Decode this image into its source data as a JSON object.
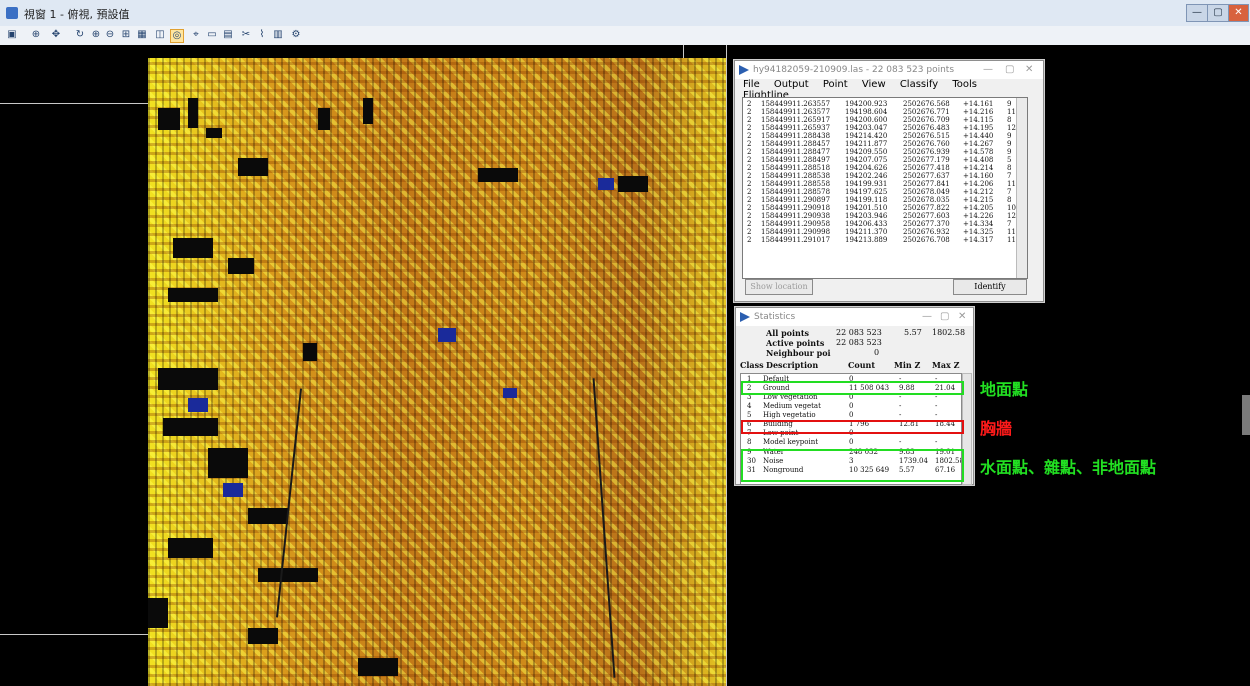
{
  "app": {
    "title": "視窗 1 - 俯視, 預設值",
    "window_buttons": [
      "—",
      "▢",
      "✕"
    ]
  },
  "toolbar": {
    "icons": [
      "open-icon",
      "zoom-icon",
      "pan-icon",
      "rotate-icon",
      "fit-icon",
      "grid-icon",
      "select-icon",
      "measure-icon",
      "cut-icon",
      "settings-icon"
    ]
  },
  "point_window": {
    "title": "hy94182059-210909.las - 22 083 523 points",
    "menu": [
      "File",
      "Output",
      "Point",
      "View",
      "Classify",
      "Tools",
      "Flightline"
    ],
    "rows": [
      [
        "2",
        "158449911.263557",
        "194200.923",
        "2502676.568",
        "+14.161",
        "9"
      ],
      [
        "2",
        "158449911.263577",
        "194198.604",
        "2502676.771",
        "+14.216",
        "11"
      ],
      [
        "2",
        "158449911.265917",
        "194200.600",
        "2502676.709",
        "+14.115",
        "8"
      ],
      [
        "2",
        "158449911.265937",
        "194203.047",
        "2502676.483",
        "+14.195",
        "12"
      ],
      [
        "2",
        "158449911.288438",
        "194214.420",
        "2502676.515",
        "+14.440",
        "9"
      ],
      [
        "2",
        "158449911.288457",
        "194211.877",
        "2502676.760",
        "+14.267",
        "9"
      ],
      [
        "2",
        "158449911.288477",
        "194209.550",
        "2502676.939",
        "+14.578",
        "9"
      ],
      [
        "2",
        "158449911.288497",
        "194207.075",
        "2502677.179",
        "+14.408",
        "5"
      ],
      [
        "2",
        "158449911.288518",
        "194204.626",
        "2502677.418",
        "+14.214",
        "8"
      ],
      [
        "2",
        "158449911.288538",
        "194202.246",
        "2502677.637",
        "+14.160",
        "7"
      ],
      [
        "2",
        "158449911.288558",
        "194199.931",
        "2502677.841",
        "+14.206",
        "11"
      ],
      [
        "2",
        "158449911.288578",
        "194197.625",
        "2502678.049",
        "+14.212",
        "7"
      ],
      [
        "2",
        "158449911.290897",
        "194199.118",
        "2502678.035",
        "+14.215",
        "8"
      ],
      [
        "2",
        "158449911.290918",
        "194201.510",
        "2502677.822",
        "+14.205",
        "10"
      ],
      [
        "2",
        "158449911.290938",
        "194203.946",
        "2502677.603",
        "+14.226",
        "12"
      ],
      [
        "2",
        "158449911.290958",
        "194206.433",
        "2502677.370",
        "+14.334",
        "7"
      ],
      [
        "2",
        "158449911.290998",
        "194211.370",
        "2502676.932",
        "+14.325",
        "11"
      ],
      [
        "2",
        "158449911.291017",
        "194213.889",
        "2502676.708",
        "+14.317",
        "11"
      ]
    ],
    "show_location": "Show location",
    "identify": "Identify"
  },
  "stats_window": {
    "title": "Statistics",
    "all_points_label": "All points",
    "all_points_count": "22 083 523",
    "all_points_min": "5.57",
    "all_points_max": "1802.58",
    "active_points_label": "Active points",
    "active_points_count": "22 083 523",
    "neighbour_label": "Neighbour poi",
    "neighbour_count": "0",
    "headers": [
      "Class",
      "Description",
      "Count",
      "Min Z",
      "Max Z"
    ],
    "rows": [
      [
        "1",
        "Default",
        "0",
        "-",
        "-"
      ],
      [
        "2",
        "Ground",
        "11 508 043",
        "9.88",
        "21.04"
      ],
      [
        "3",
        "Low vegetation",
        "0",
        "-",
        "-"
      ],
      [
        "4",
        "Medium vegetat",
        "0",
        "-",
        "-"
      ],
      [
        "5",
        "High vegetatio",
        "0",
        "-",
        "-"
      ],
      [
        "6",
        "Building",
        "1 796",
        "12.81",
        "18.44"
      ],
      [
        "7",
        "Low point",
        "0",
        "-",
        "-"
      ],
      [
        "8",
        "Model keypoint",
        "0",
        "-",
        "-"
      ],
      [
        "9",
        "Water",
        "248 032",
        "9.83",
        "19.01"
      ],
      [
        "30",
        "Noise",
        "3",
        "1739.04",
        "1802.58"
      ],
      [
        "31",
        "Nonground",
        "10 325 649",
        "5.57",
        "67.16"
      ]
    ]
  },
  "annotations": {
    "ground": "地面點",
    "wall": "胸牆",
    "others": "水面點、雜點、非地面點"
  },
  "colors": {
    "annotation_green": "#22e022",
    "annotation_red": "#ff1a1a",
    "highlight_green": "#22dd22",
    "highlight_red": "#e31010"
  }
}
